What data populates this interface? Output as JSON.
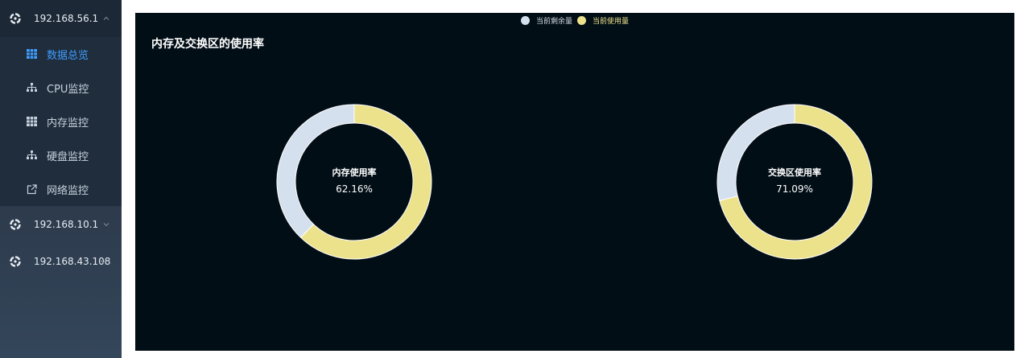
{
  "sidebar": {
    "hosts": [
      {
        "label": "192.168.56.1",
        "expanded": true
      },
      {
        "label": "192.168.10.1",
        "expanded": false
      },
      {
        "label": "192.168.43.108",
        "expanded": false
      }
    ],
    "submenu": [
      {
        "label": "数据总览",
        "icon": "grid-icon",
        "active": true
      },
      {
        "label": "CPU监控",
        "icon": "sitemap-icon",
        "active": false
      },
      {
        "label": "内存监控",
        "icon": "grid-icon",
        "active": false
      },
      {
        "label": "硬盘监控",
        "icon": "sitemap-icon",
        "active": false
      },
      {
        "label": "网络监控",
        "icon": "external-link-icon",
        "active": false
      }
    ]
  },
  "panel": {
    "title": "内存及交换区的使用率"
  },
  "legend": [
    {
      "label": "当前剩余量",
      "color": "#d5e0ef"
    },
    {
      "label": "当前使用量",
      "color": "#ece28c"
    }
  ],
  "chart_data": {
    "type": "pie",
    "charts": [
      {
        "center_label": "内存使用率",
        "value_text": "62.16%",
        "used": 62.16,
        "remaining": 37.84
      },
      {
        "center_label": "交换区使用率",
        "value_text": "71.09%",
        "used": 71.09,
        "remaining": 28.91
      }
    ],
    "series_colors": {
      "remaining": "#d5e0ef",
      "used": "#ece28c"
    }
  }
}
